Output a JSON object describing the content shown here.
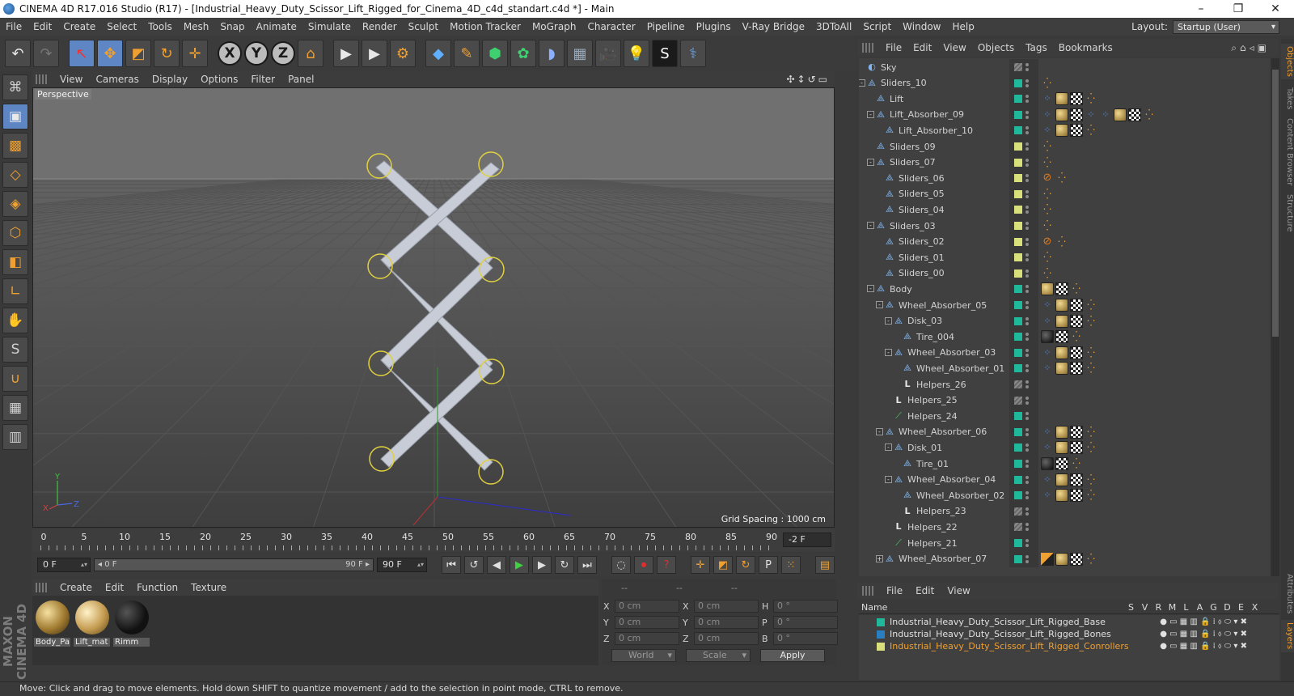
{
  "window": {
    "title": "CINEMA 4D R17.016 Studio (R17) - [Industrial_Heavy_Duty_Scissor_Lift_Rigged_for_Cinema_4D_c4d_standart.c4d *] - Main",
    "minimize": "–",
    "maximize": "❐",
    "close": "✕"
  },
  "menubar": {
    "items": [
      "File",
      "Edit",
      "Create",
      "Select",
      "Tools",
      "Mesh",
      "Snap",
      "Animate",
      "Simulate",
      "Render",
      "Sculpt",
      "Motion Tracker",
      "MoGraph",
      "Character",
      "Pipeline",
      "Plugins",
      "V-Ray Bridge",
      "3DToAll",
      "Script",
      "Window",
      "Help"
    ],
    "layout_label": "Layout:",
    "layout_value": "Startup (User)"
  },
  "toolbar": {
    "undo": "↶",
    "redo": "↷",
    "live_select": "↖",
    "move": "✥",
    "scale": "◩",
    "rotate": "↻",
    "transform": "✛",
    "x_axis": "X",
    "y_axis": "Y",
    "z_axis": "Z",
    "coord_system": "⌂",
    "render_view": "▶",
    "render_pic": "▶",
    "render_settings": "⚙",
    "cube": "◆",
    "pen": "✎",
    "subdiv": "⬢",
    "mograph": "✿",
    "deformer": "◗",
    "floor": "▦",
    "camera": "🎥",
    "light": "💡",
    "material": "S",
    "python": "⚕"
  },
  "leftbar": {
    "tools": [
      "⌘",
      "▣",
      "▩",
      "◇",
      "◈",
      "⬡",
      "◧",
      "∟",
      "✋",
      "S",
      "∪",
      "▦",
      "▥"
    ]
  },
  "viewport": {
    "menu": [
      "View",
      "Cameras",
      "Display",
      "Options",
      "Filter",
      "Panel"
    ],
    "nav_icons": "✣↕↺▭",
    "label": "Perspective",
    "grid_spacing": "Grid Spacing : 1000 cm",
    "axis_y": "Y",
    "axis_x": "X",
    "axis_z": "Z"
  },
  "timeline": {
    "ticks": [
      "0",
      "5",
      "10",
      "15",
      "20",
      "25",
      "30",
      "35",
      "40",
      "45",
      "50",
      "55",
      "60",
      "65",
      "70",
      "75",
      "80",
      "85",
      "90"
    ],
    "current_frame": "-2 F"
  },
  "playback": {
    "start_field": "0 F",
    "range_start": "◂ 0 F",
    "range_end": "90 F ▸",
    "end_field": "90 F",
    "buttons": {
      "first": "⏮",
      "prev_key": "↺",
      "prev": "◀",
      "play": "▶",
      "next": "▶",
      "next_key": "↻",
      "last": "⏭",
      "motion": "◌",
      "record": "⏺",
      "help": "?",
      "move_key": "✛",
      "scale_key": "◩",
      "rot_key": "↻",
      "param_key": "P",
      "grid_key": "⁙",
      "timeline_btn": "▤"
    }
  },
  "material_manager": {
    "menu": [
      "Create",
      "Edit",
      "Function",
      "Texture"
    ],
    "materials": [
      "Body_Pa",
      "Lift_mat",
      "Rimm"
    ]
  },
  "coordinates": {
    "header": [
      "--",
      "--",
      "--"
    ],
    "rows": [
      {
        "a_lbl": "X",
        "a_val": "0 cm",
        "b_lbl": "X",
        "b_val": "0 cm",
        "c_lbl": "H",
        "c_val": "0 °"
      },
      {
        "a_lbl": "Y",
        "a_val": "0 cm",
        "b_lbl": "Y",
        "b_val": "0 cm",
        "c_lbl": "P",
        "c_val": "0 °"
      },
      {
        "a_lbl": "Z",
        "a_val": "0 cm",
        "b_lbl": "Z",
        "b_val": "0 cm",
        "c_lbl": "B",
        "c_val": "0 °"
      }
    ],
    "space_select": "World",
    "mode_select": "Scale",
    "apply": "Apply"
  },
  "status": "Move: Click and drag to move elements. Hold down SHIFT to quantize movement / add to the selection in point mode, CTRL to remove.",
  "object_manager": {
    "menu": [
      "File",
      "Edit",
      "View",
      "Objects",
      "Tags",
      "Bookmarks"
    ],
    "icons": "⌕⌂◃▣",
    "rows": [
      {
        "name": "Sky",
        "depth": 0,
        "exp": "",
        "icon": "sky",
        "color": "",
        "tags": []
      },
      {
        "name": "Sliders_10",
        "depth": 0,
        "exp": "-",
        "icon": "null",
        "color": "#1fb89a",
        "tags": [
          "orng"
        ]
      },
      {
        "name": "Lift",
        "depth": 1,
        "exp": "",
        "icon": "null",
        "color": "#1fb89a",
        "tags": [
          "ik",
          "mat",
          "check",
          "orng"
        ]
      },
      {
        "name": "Lift_Absorber_09",
        "depth": 1,
        "exp": "-",
        "icon": "null",
        "color": "#1fb89a",
        "tags": [
          "ik",
          "mat",
          "check",
          "ik",
          "ik",
          "mat",
          "check",
          "orng"
        ]
      },
      {
        "name": "Lift_Absorber_10",
        "depth": 2,
        "exp": "",
        "icon": "null",
        "color": "#1fb89a",
        "tags": [
          "ik",
          "mat",
          "check",
          "orng"
        ]
      },
      {
        "name": "Sliders_09",
        "depth": 1,
        "exp": "",
        "icon": "null",
        "color": "#d7e07a",
        "tags": [
          "orng"
        ]
      },
      {
        "name": "Sliders_07",
        "depth": 1,
        "exp": "-",
        "icon": "null",
        "color": "#d7e07a",
        "tags": [
          "orng"
        ]
      },
      {
        "name": "Sliders_06",
        "depth": 2,
        "exp": "",
        "icon": "null",
        "color": "#d7e07a",
        "tags": [
          "no",
          "orng"
        ]
      },
      {
        "name": "Sliders_05",
        "depth": 2,
        "exp": "",
        "icon": "null",
        "color": "#d7e07a",
        "tags": [
          "orng"
        ]
      },
      {
        "name": "Sliders_04",
        "depth": 2,
        "exp": "",
        "icon": "null",
        "color": "#d7e07a",
        "tags": [
          "orng"
        ]
      },
      {
        "name": "Sliders_03",
        "depth": 1,
        "exp": "-",
        "icon": "null",
        "color": "#d7e07a",
        "tags": [
          "orng"
        ]
      },
      {
        "name": "Sliders_02",
        "depth": 2,
        "exp": "",
        "icon": "null",
        "color": "#d7e07a",
        "tags": [
          "no",
          "orng"
        ]
      },
      {
        "name": "Sliders_01",
        "depth": 2,
        "exp": "",
        "icon": "null",
        "color": "#d7e07a",
        "tags": [
          "orng"
        ]
      },
      {
        "name": "Sliders_00",
        "depth": 2,
        "exp": "",
        "icon": "null",
        "color": "#d7e07a",
        "tags": [
          "orng"
        ]
      },
      {
        "name": "Body",
        "depth": 1,
        "exp": "-",
        "icon": "null",
        "color": "#1fb89a",
        "tags": [
          "mat",
          "check",
          "orng"
        ]
      },
      {
        "name": "Wheel_Absorber_05",
        "depth": 2,
        "exp": "-",
        "icon": "null",
        "color": "#1fb89a",
        "tags": [
          "ik",
          "mat",
          "check",
          "orng"
        ]
      },
      {
        "name": "Disk_03",
        "depth": 3,
        "exp": "-",
        "icon": "null",
        "color": "#1fb89a",
        "tags": [
          "ik",
          "mat",
          "check",
          "orng"
        ]
      },
      {
        "name": "Tire_004",
        "depth": 4,
        "exp": "",
        "icon": "null",
        "color": "#1fb89a",
        "tags": [
          "matdark",
          "check",
          "orng"
        ]
      },
      {
        "name": "Wheel_Absorber_03",
        "depth": 3,
        "exp": "-",
        "icon": "null",
        "color": "#1fb89a",
        "tags": [
          "ik",
          "mat",
          "check",
          "orng"
        ]
      },
      {
        "name": "Wheel_Absorber_01",
        "depth": 4,
        "exp": "",
        "icon": "null",
        "color": "#1fb89a",
        "tags": [
          "ik",
          "mat",
          "check",
          "orng"
        ]
      },
      {
        "name": "Helpers_26",
        "depth": 4,
        "exp": "",
        "icon": "helper",
        "color": "",
        "tags": []
      },
      {
        "name": "Helpers_25",
        "depth": 3,
        "exp": "",
        "icon": "helper",
        "color": "",
        "tags": []
      },
      {
        "name": "Helpers_24",
        "depth": 3,
        "exp": "",
        "icon": "bone",
        "color": "#1fb89a",
        "tags": []
      },
      {
        "name": "Wheel_Absorber_06",
        "depth": 2,
        "exp": "-",
        "icon": "null",
        "color": "#1fb89a",
        "tags": [
          "ik",
          "mat",
          "check",
          "orng"
        ]
      },
      {
        "name": "Disk_01",
        "depth": 3,
        "exp": "-",
        "icon": "null",
        "color": "#1fb89a",
        "tags": [
          "ik",
          "mat",
          "check",
          "orng"
        ]
      },
      {
        "name": "Tire_01",
        "depth": 4,
        "exp": "",
        "icon": "null",
        "color": "#1fb89a",
        "tags": [
          "matdark",
          "check",
          "orng"
        ]
      },
      {
        "name": "Wheel_Absorber_04",
        "depth": 3,
        "exp": "-",
        "icon": "null",
        "color": "#1fb89a",
        "tags": [
          "ik",
          "mat",
          "check",
          "orng"
        ]
      },
      {
        "name": "Wheel_Absorber_02",
        "depth": 4,
        "exp": "",
        "icon": "null",
        "color": "#1fb89a",
        "tags": [
          "ik",
          "mat",
          "check",
          "orng"
        ]
      },
      {
        "name": "Helpers_23",
        "depth": 4,
        "exp": "",
        "icon": "helper",
        "color": "",
        "tags": []
      },
      {
        "name": "Helpers_22",
        "depth": 3,
        "exp": "",
        "icon": "helper",
        "color": "",
        "tags": []
      },
      {
        "name": "Helpers_21",
        "depth": 3,
        "exp": "",
        "icon": "bone",
        "color": "#1fb89a",
        "tags": []
      },
      {
        "name": "Wheel_Absorber_07",
        "depth": 2,
        "exp": "+",
        "icon": "null",
        "color": "#1fb89a",
        "tags": [
          "xp",
          "mat",
          "check",
          "orng"
        ]
      }
    ]
  },
  "right_tabs": [
    "Objects",
    "Takes",
    "Content Browser",
    "Structure",
    "Attributes",
    "Layers"
  ],
  "layer_manager": {
    "menu": [
      "File",
      "Edit",
      "View"
    ],
    "columns": {
      "name": "Name",
      "flags": [
        "S",
        "V",
        "R",
        "M",
        "L",
        "A",
        "G",
        "D",
        "E",
        "X"
      ]
    },
    "layers": [
      {
        "name": "Industrial_Heavy_Duty_Scissor_Lift_Rigged_Base",
        "color": "#1fb89a",
        "highlight": false
      },
      {
        "name": "Industrial_Heavy_Duty_Scissor_Lift_Rigged_Bones",
        "color": "#2a7fc0",
        "highlight": false
      },
      {
        "name": "Industrial_Heavy_Duty_Scissor_Lift_Rigged_Conrollers",
        "color": "#d7e07a",
        "highlight": true
      }
    ],
    "flag_glyphs": [
      "●",
      "▭",
      "▦",
      "▥",
      "🔒",
      "⁞",
      "⬨",
      "⬭",
      "▾",
      "✖"
    ]
  }
}
